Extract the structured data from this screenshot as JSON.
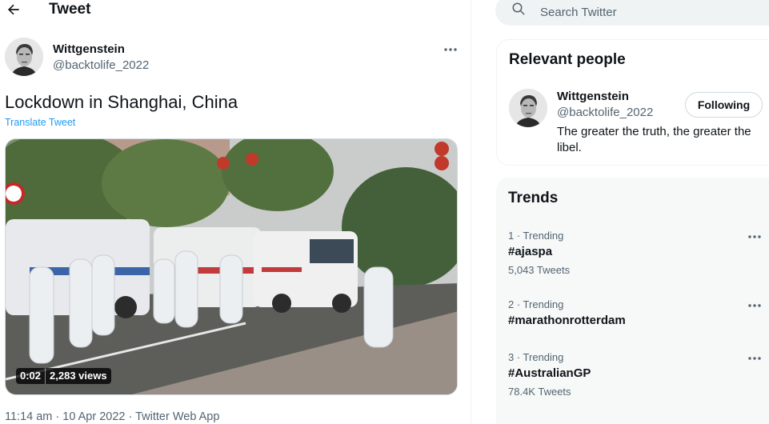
{
  "header": {
    "title": "Tweet",
    "back_icon": "arrow-left-icon"
  },
  "tweet": {
    "author": {
      "name": "Wittgenstein",
      "handle": "@backtolife_2022"
    },
    "text": "Lockdown in Shanghai, China",
    "translate_label": "Translate Tweet",
    "video": {
      "duration": "0:02",
      "views": "2,283 views"
    },
    "timestamp": "11:14 am · 10 Apr 2022 · Twitter Web App"
  },
  "sidebar": {
    "search": {
      "placeholder": "Search Twitter",
      "icon": "search-icon"
    },
    "relevant_people": {
      "title": "Relevant people",
      "person": {
        "name": "Wittgenstein",
        "handle": "@backtolife_2022",
        "bio": "The greater the truth, the greater the libel.",
        "follow_label": "Following"
      }
    },
    "trends": {
      "title": "Trends",
      "items": [
        {
          "meta": "1 · Trending",
          "tag": "#ajaspa",
          "count": "5,043 Tweets"
        },
        {
          "meta": "2 · Trending",
          "tag": "#marathonrotterdam",
          "count": ""
        },
        {
          "meta": "3 · Trending",
          "tag": "#AustralianGP",
          "count": "78.4K Tweets"
        }
      ]
    }
  },
  "colors": {
    "accent": "#1d9bf0",
    "text_primary": "#0f1419",
    "text_secondary": "#536471"
  }
}
